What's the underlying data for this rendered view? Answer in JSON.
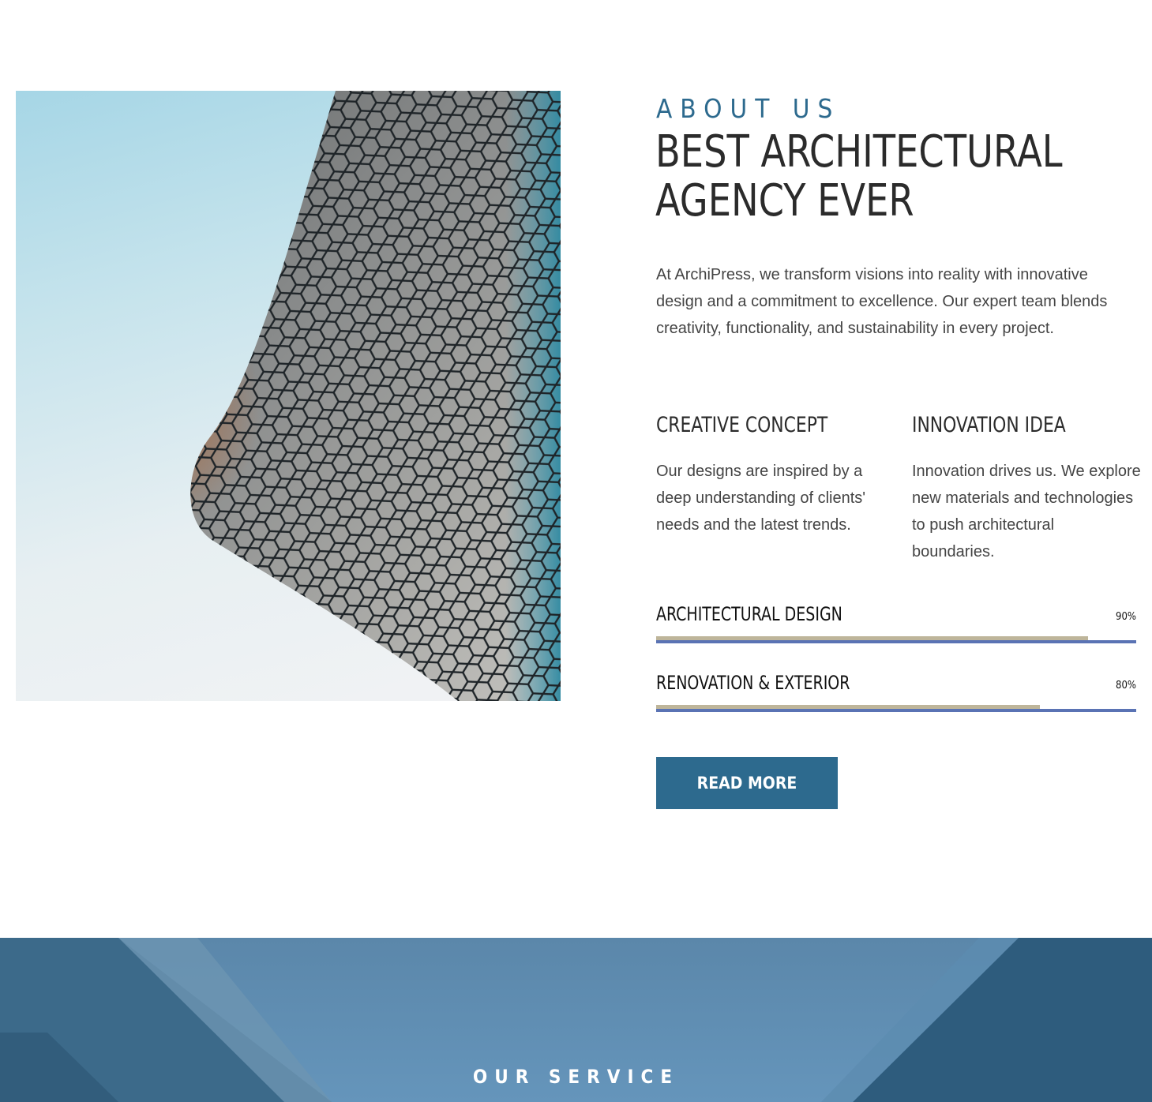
{
  "about": {
    "eyebrow": "ABOUT US",
    "title": "BEST ARCHITECTURAL AGENCY EVER",
    "description": "At ArchiPress, we transform visions into reality with innovative design and a commitment to excellence. Our expert team blends creativity, functionality, and sustainability in every project.",
    "features": [
      {
        "title": "CREATIVE CONCEPT",
        "text": "Our designs are inspired by a deep understanding of clients' needs and the latest trends."
      },
      {
        "title": "INNOVATION IDEA",
        "text": "Innovation drives us. We explore new materials and technologies to push architectural boundaries."
      }
    ],
    "skills": [
      {
        "label": "ARCHITECTURAL DESIGN",
        "percent_text": "90%",
        "value": 0.9
      },
      {
        "label": "RENOVATION & EXTERIOR",
        "percent_text": "80%",
        "value": 0.8
      }
    ],
    "button_label": "READ MORE"
  },
  "service": {
    "eyebrow": "OUR SERVICE"
  },
  "colors": {
    "accent": "#2d6a8e",
    "heading": "#2b2b2b",
    "body_text": "#444444",
    "skill_fill": "#beb59a",
    "skill_line": "#5a73b4"
  }
}
